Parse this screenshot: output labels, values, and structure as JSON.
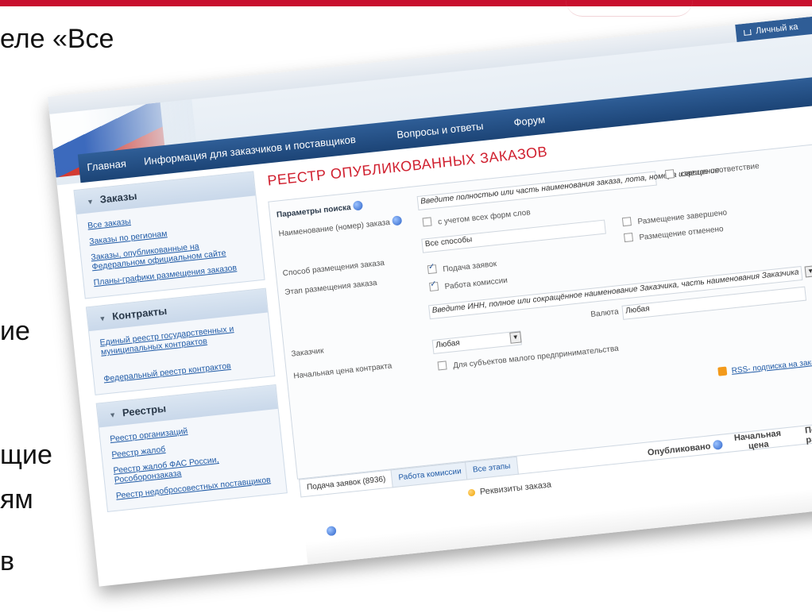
{
  "slide": {
    "text_top": "еле «Все",
    "text_fragments": [
      "ие",
      "щие",
      "ям",
      "в"
    ]
  },
  "site": {
    "login_label": "Личный ка",
    "nav": [
      "Главная",
      "Информация для заказчиков и поставщиков",
      "Вопросы и ответы",
      "Форум"
    ]
  },
  "sidebar": {
    "sections": [
      {
        "title": "Заказы",
        "items": [
          "Все заказы",
          "Заказы по регионам",
          "Заказы, опубликованные на Федеральном официальном сайте",
          "Планы-графики размещения заказов"
        ]
      },
      {
        "title": "Контракты",
        "items": [
          "Единый реестр государственных и муниципальных контрактов",
          "Федеральный реестр контрактов"
        ]
      },
      {
        "title": "Реестры",
        "items": [
          "Реестр организаций",
          "Реестр жалоб",
          "Реестр жалоб ФАС России, Рособоронзаказа",
          "Реестр недобросовестных поставщиков"
        ]
      }
    ]
  },
  "main": {
    "title": "РЕЕСТР ОПУБЛИКОВАННЫХ ЗАКАЗОВ",
    "params_label": "Параметры поиска",
    "name_label": "Наименование (номер) заказа",
    "name_placeholder": "Введите полностью или часть наименования заказа, лота, номера извещения",
    "strict_label": "строгое соответствие",
    "wordforms_label": "с учетом всех форм слов",
    "method_label": "Способ размещения заказа",
    "method_value": "Все способы",
    "stage_label": "Этап размещения заказа",
    "stage_options": [
      "Подача заявок",
      "Работа комиссии"
    ],
    "stage_options_right": [
      "Размещение завершено",
      "Размещение отменено"
    ],
    "customer_label": "Заказчик",
    "customer_placeholder": "Введите ИНН, полное или сокращённое наименование Заказчика, часть наименования Заказчика",
    "currency_label": "Валюта",
    "currency_value": "Любая",
    "price_label": "Начальная цена контракта",
    "price_value": "Любая",
    "small_business_label": "Для субъектов малого предпринимательства",
    "rss_label": "RSS- подписка на заказы по у"
  },
  "results": {
    "tabs": [
      "Подача заявок (8936)",
      "Работа комиссии",
      "Все этапы"
    ],
    "headers": [
      "Реквизиты заказа",
      "Опубликовано",
      "Начальная цена",
      "Посл разм"
    ]
  }
}
